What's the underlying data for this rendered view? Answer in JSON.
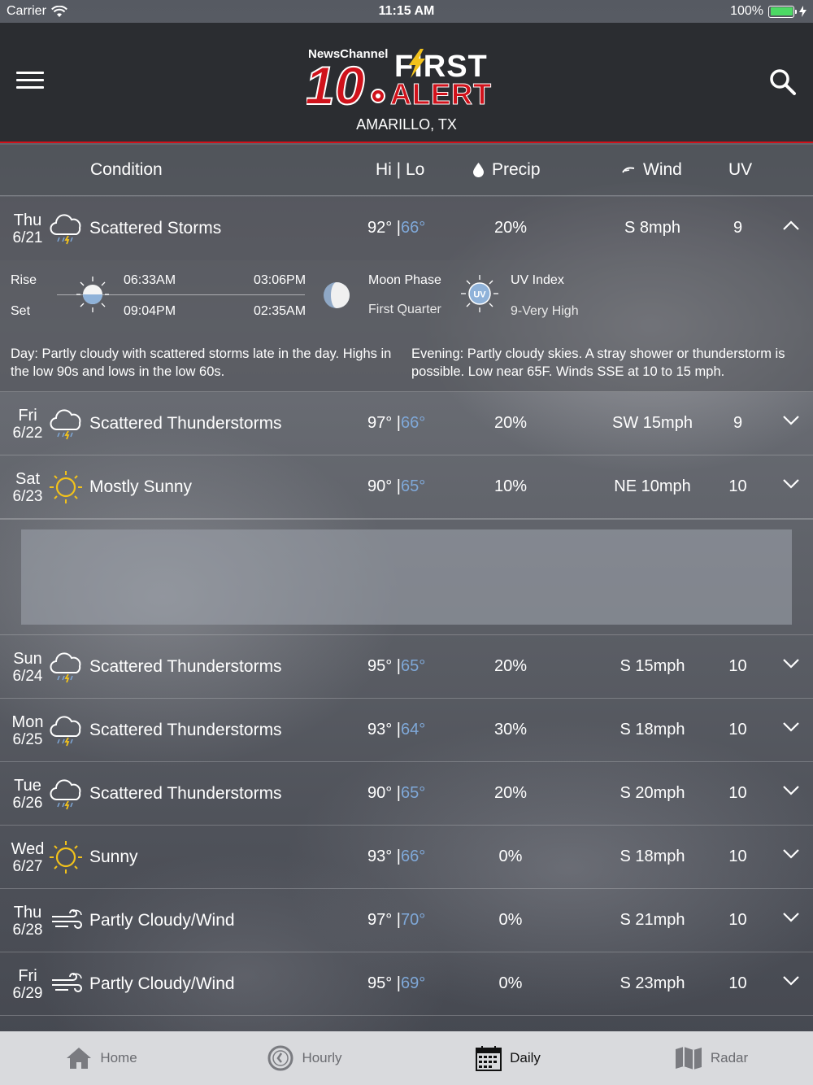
{
  "status_bar": {
    "carrier": "Carrier",
    "time": "11:15 AM",
    "battery": "100%"
  },
  "header": {
    "logo_small": "NewsChannel",
    "logo_number": "10",
    "logo_first": "FIRST",
    "logo_alert": "ALERT",
    "location": "AMARILLO, TX"
  },
  "columns": {
    "condition": "Condition",
    "hilo": "Hi | Lo",
    "precip": "Precip",
    "wind": "Wind",
    "uv": "UV"
  },
  "expanded": {
    "day": "Thu",
    "date": "6/21",
    "icon": "thunderstorm-cloud-icon",
    "condition": "Scattered Storms",
    "hi": "92°",
    "lo": "66°",
    "precip": "20%",
    "wind": "S 8mph",
    "uv": "9",
    "rise_label": "Rise",
    "set_label": "Set",
    "sunrise": "06:33AM",
    "sunset": "09:04PM",
    "moonrise": "03:06PM",
    "moonset": "02:35AM",
    "moon_phase_label": "Moon Phase",
    "moon_phase": "First Quarter",
    "uv_index_label": "UV Index",
    "uv_index": "9-Very High",
    "uv_badge": "UV",
    "day_label": "Day",
    "day_text": ": Partly cloudy with scattered storms late in the day. Highs in the low 90s and lows in the low 60s.",
    "evening_label": "Evening",
    "evening_text": ": Partly cloudy skies. A stray shower or thunderstorm is possible. Low near 65F. Winds SSE at 10 to 15 mph."
  },
  "days": [
    {
      "day": "Fri",
      "date": "6/22",
      "icon": "thunderstorm-cloud-icon",
      "condition": "Scattered Thunderstorms",
      "hi": "97°",
      "lo": "66°",
      "precip": "20%",
      "wind": "SW 15mph",
      "uv": "9"
    },
    {
      "day": "Sat",
      "date": "6/23",
      "icon": "sun-icon",
      "condition": "Mostly Sunny",
      "hi": "90°",
      "lo": "65°",
      "precip": "10%",
      "wind": "NE 10mph",
      "uv": "10"
    },
    {
      "day": "Sun",
      "date": "6/24",
      "icon": "thunderstorm-cloud-icon",
      "condition": "Scattered Thunderstorms",
      "hi": "95°",
      "lo": "65°",
      "precip": "20%",
      "wind": "S 15mph",
      "uv": "10"
    },
    {
      "day": "Mon",
      "date": "6/25",
      "icon": "thunderstorm-cloud-icon",
      "condition": "Scattered Thunderstorms",
      "hi": "93°",
      "lo": "64°",
      "precip": "30%",
      "wind": "S 18mph",
      "uv": "10"
    },
    {
      "day": "Tue",
      "date": "6/26",
      "icon": "thunderstorm-cloud-icon",
      "condition": "Scattered Thunderstorms",
      "hi": "90°",
      "lo": "65°",
      "precip": "20%",
      "wind": "S 20mph",
      "uv": "10"
    },
    {
      "day": "Wed",
      "date": "6/27",
      "icon": "sun-icon",
      "condition": "Sunny",
      "hi": "93°",
      "lo": "66°",
      "precip": "0%",
      "wind": "S 18mph",
      "uv": "10"
    },
    {
      "day": "Thu",
      "date": "6/28",
      "icon": "wind-icon",
      "condition": "Partly Cloudy/Wind",
      "hi": "97°",
      "lo": "70°",
      "precip": "0%",
      "wind": "S 21mph",
      "uv": "10"
    },
    {
      "day": "Fri",
      "date": "6/29",
      "icon": "wind-icon",
      "condition": "Partly Cloudy/Wind",
      "hi": "95°",
      "lo": "69°",
      "precip": "0%",
      "wind": "S 23mph",
      "uv": "10"
    }
  ],
  "tabs": [
    {
      "label": "Home",
      "icon": "home-icon"
    },
    {
      "label": "Hourly",
      "icon": "clock-icon"
    },
    {
      "label": "Daily",
      "icon": "calendar-icon"
    },
    {
      "label": "Radar",
      "icon": "map-icon"
    }
  ],
  "colors": {
    "alert_red": "#d0121b",
    "low_temp_blue": "#7fa8d8",
    "sun_yellow": "#f2c21b"
  }
}
